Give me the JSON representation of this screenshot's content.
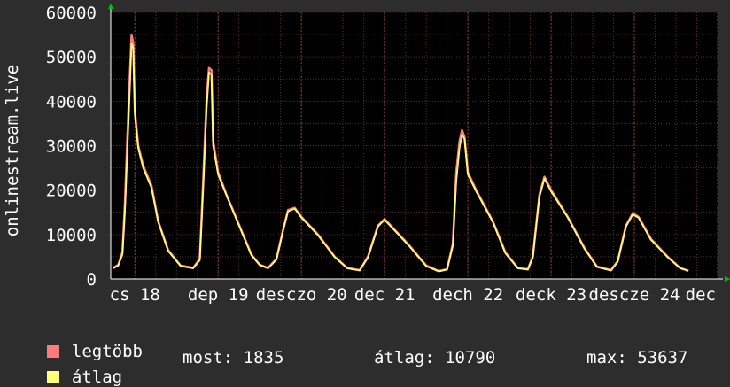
{
  "colors": {
    "background": "#2d2d2d",
    "plot_background": "#000000",
    "grid": "#5a2a2a",
    "axis": "#ffffff",
    "max_series": "#ff7b7b",
    "avg_series": "#ffff7a",
    "arrow": "#00c000"
  },
  "legend": {
    "max_label": "legtöbb",
    "avg_label": "átlag"
  },
  "stats": {
    "now": "most: 1835",
    "avg": "átlag: 10790",
    "max": "max: 53637"
  },
  "chart_data": {
    "type": "line",
    "title": "",
    "ylabel": "onlinestream.live",
    "xlabel": "",
    "ylim": [
      0,
      60000
    ],
    "xlim": [
      0,
      7
    ],
    "grid": true,
    "y_ticks": [
      0,
      10000,
      20000,
      30000,
      40000,
      50000,
      60000
    ],
    "y_tick_labels": [
      "0",
      "10000",
      "20000",
      "30000",
      "40000",
      "50000",
      "60000"
    ],
    "x_ticks": [
      {
        "x": 0.0,
        "label": "cs 18"
      },
      {
        "x": 1.0,
        "label": "dep 19"
      },
      {
        "x": 2.0,
        "label": "desczo 20"
      },
      {
        "x": 3.0,
        "label": "dec 21"
      },
      {
        "x": 4.0,
        "label": "dech 22"
      },
      {
        "x": 5.0,
        "label": "deck 23"
      },
      {
        "x": 6.0,
        "label": "descze 24"
      },
      {
        "x": 7.0,
        "label": "dec"
      }
    ],
    "legend_position": "bottom-left",
    "series": [
      {
        "name": "legtöbb",
        "points": [
          [
            -0.26,
            2500
          ],
          [
            -0.2,
            3200
          ],
          [
            -0.15,
            6000
          ],
          [
            -0.12,
            17000
          ],
          [
            -0.09,
            32000
          ],
          [
            -0.06,
            46000
          ],
          [
            -0.04,
            55000
          ],
          [
            -0.02,
            53000
          ],
          [
            0.0,
            38000
          ],
          [
            0.04,
            30000
          ],
          [
            0.1,
            25500
          ],
          [
            0.2,
            21000
          ],
          [
            0.28,
            13000
          ],
          [
            0.4,
            6500
          ],
          [
            0.55,
            3000
          ],
          [
            0.7,
            2500
          ],
          [
            0.78,
            4500
          ],
          [
            0.82,
            22000
          ],
          [
            0.86,
            40000
          ],
          [
            0.89,
            47500
          ],
          [
            0.92,
            47000
          ],
          [
            0.94,
            31000
          ],
          [
            1.0,
            24000
          ],
          [
            1.1,
            19000
          ],
          [
            1.2,
            14500
          ],
          [
            1.3,
            10000
          ],
          [
            1.4,
            5500
          ],
          [
            1.5,
            3200
          ],
          [
            1.6,
            2500
          ],
          [
            1.7,
            4500
          ],
          [
            1.78,
            11000
          ],
          [
            1.84,
            15500
          ],
          [
            1.92,
            16000
          ],
          [
            2.0,
            14000
          ],
          [
            2.2,
            10000
          ],
          [
            2.4,
            5000
          ],
          [
            2.55,
            2500
          ],
          [
            2.7,
            2000
          ],
          [
            2.8,
            5000
          ],
          [
            2.92,
            12000
          ],
          [
            3.0,
            13500
          ],
          [
            3.1,
            11500
          ],
          [
            3.3,
            7500
          ],
          [
            3.5,
            3000
          ],
          [
            3.65,
            1800
          ],
          [
            3.75,
            2200
          ],
          [
            3.82,
            8000
          ],
          [
            3.86,
            24000
          ],
          [
            3.9,
            31000
          ],
          [
            3.93,
            33500
          ],
          [
            3.96,
            32000
          ],
          [
            4.0,
            24000
          ],
          [
            4.1,
            20000
          ],
          [
            4.3,
            13000
          ],
          [
            4.45,
            6000
          ],
          [
            4.6,
            2500
          ],
          [
            4.72,
            2200
          ],
          [
            4.78,
            5000
          ],
          [
            4.86,
            19000
          ],
          [
            4.92,
            23000
          ],
          [
            5.0,
            20000
          ],
          [
            5.2,
            14000
          ],
          [
            5.4,
            7000
          ],
          [
            5.55,
            2800
          ],
          [
            5.72,
            2000
          ],
          [
            5.8,
            4000
          ],
          [
            5.9,
            12000
          ],
          [
            5.98,
            14800
          ],
          [
            6.05,
            14000
          ],
          [
            6.2,
            9000
          ],
          [
            6.4,
            5000
          ],
          [
            6.55,
            2500
          ],
          [
            6.65,
            1835
          ]
        ]
      },
      {
        "name": "átlag",
        "points": [
          [
            -0.26,
            2400
          ],
          [
            -0.2,
            3000
          ],
          [
            -0.15,
            5500
          ],
          [
            -0.12,
            15000
          ],
          [
            -0.09,
            29000
          ],
          [
            -0.06,
            43000
          ],
          [
            -0.04,
            53000
          ],
          [
            -0.02,
            52000
          ],
          [
            0.0,
            37000
          ],
          [
            0.04,
            29500
          ],
          [
            0.1,
            25000
          ],
          [
            0.2,
            20500
          ],
          [
            0.28,
            12800
          ],
          [
            0.4,
            6300
          ],
          [
            0.55,
            2900
          ],
          [
            0.7,
            2400
          ],
          [
            0.78,
            4200
          ],
          [
            0.82,
            20000
          ],
          [
            0.86,
            38000
          ],
          [
            0.89,
            46500
          ],
          [
            0.92,
            46000
          ],
          [
            0.94,
            30000
          ],
          [
            1.0,
            23500
          ],
          [
            1.1,
            18800
          ],
          [
            1.2,
            14300
          ],
          [
            1.3,
            9800
          ],
          [
            1.4,
            5300
          ],
          [
            1.5,
            3100
          ],
          [
            1.6,
            2400
          ],
          [
            1.7,
            4300
          ],
          [
            1.78,
            10800
          ],
          [
            1.84,
            15200
          ],
          [
            1.92,
            15800
          ],
          [
            2.0,
            13800
          ],
          [
            2.2,
            9800
          ],
          [
            2.4,
            4900
          ],
          [
            2.55,
            2400
          ],
          [
            2.7,
            1900
          ],
          [
            2.8,
            4800
          ],
          [
            2.92,
            11800
          ],
          [
            3.0,
            13300
          ],
          [
            3.1,
            11300
          ],
          [
            3.3,
            7300
          ],
          [
            3.5,
            2900
          ],
          [
            3.65,
            1700
          ],
          [
            3.75,
            2100
          ],
          [
            3.82,
            7500
          ],
          [
            3.86,
            22000
          ],
          [
            3.9,
            29500
          ],
          [
            3.93,
            32500
          ],
          [
            3.96,
            31500
          ],
          [
            4.0,
            23500
          ],
          [
            4.1,
            19700
          ],
          [
            4.3,
            12800
          ],
          [
            4.45,
            5800
          ],
          [
            4.6,
            2400
          ],
          [
            4.72,
            2100
          ],
          [
            4.78,
            4800
          ],
          [
            4.86,
            18500
          ],
          [
            4.92,
            22600
          ],
          [
            5.0,
            19700
          ],
          [
            5.2,
            13800
          ],
          [
            5.4,
            6800
          ],
          [
            5.55,
            2700
          ],
          [
            5.72,
            1900
          ],
          [
            5.8,
            3800
          ],
          [
            5.9,
            11800
          ],
          [
            5.98,
            14500
          ],
          [
            6.05,
            13800
          ],
          [
            6.2,
            8800
          ],
          [
            6.4,
            4900
          ],
          [
            6.55,
            2400
          ],
          [
            6.65,
            1835
          ]
        ]
      }
    ]
  }
}
